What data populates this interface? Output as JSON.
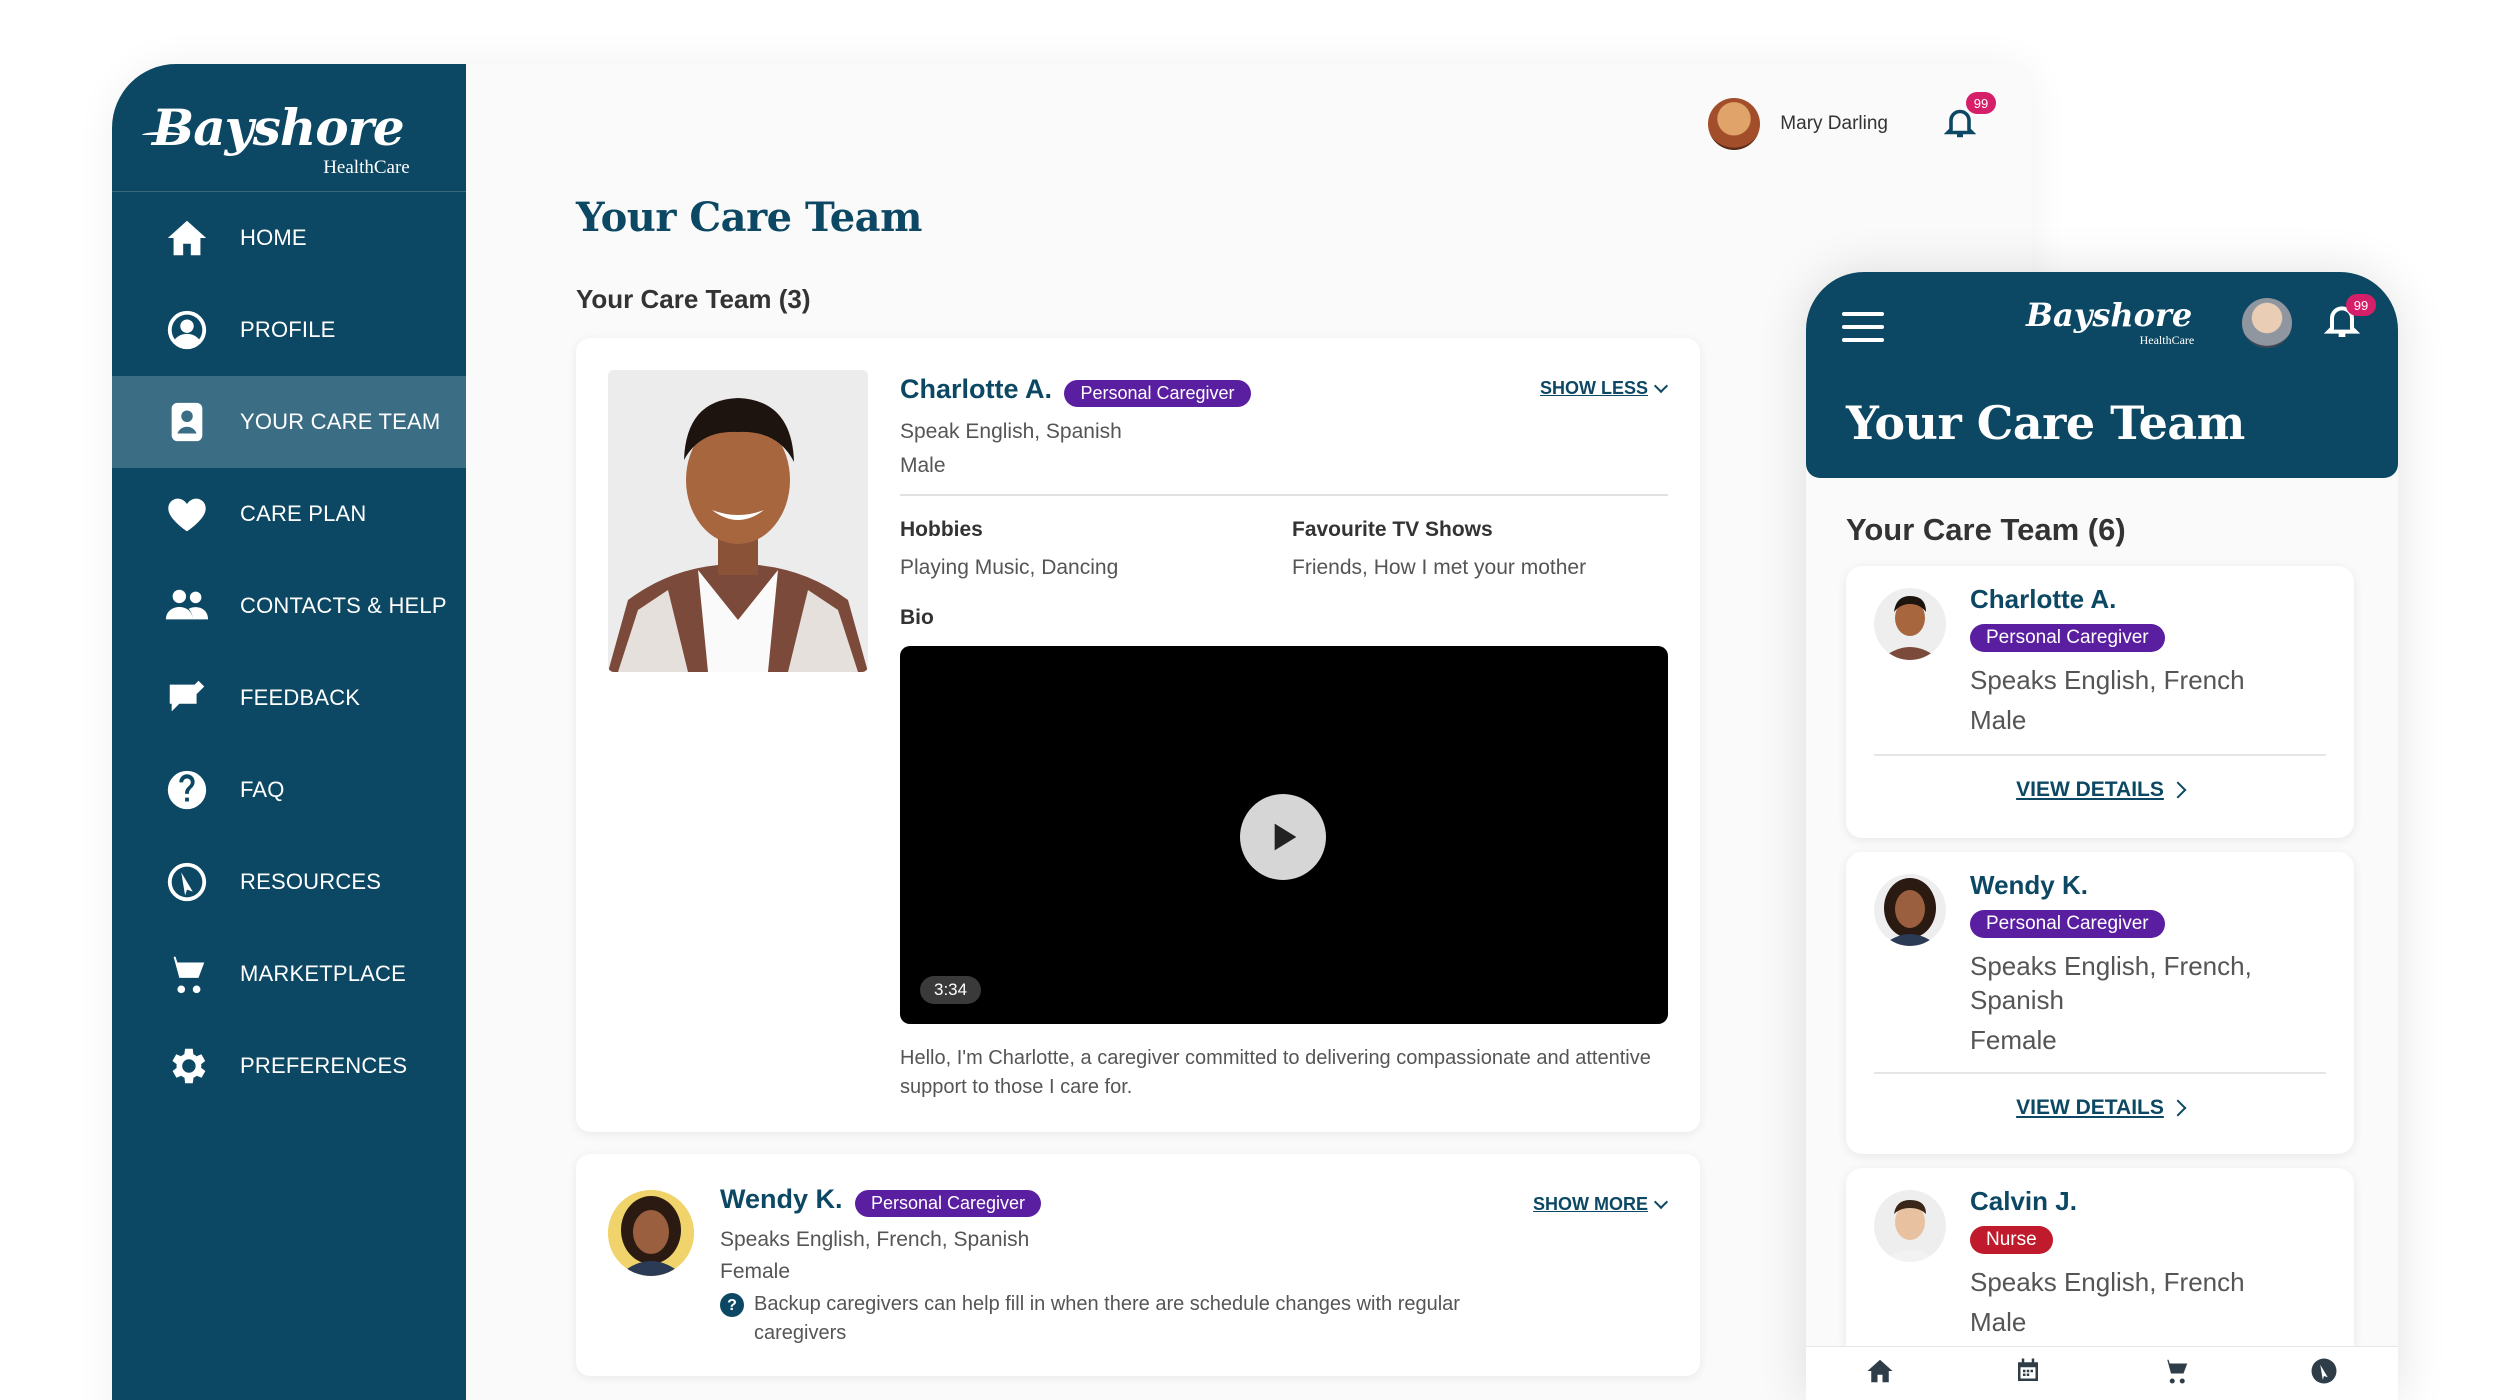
{
  "desktop": {
    "brand": "Bayshore",
    "brand_sub": "HealthCare",
    "nav": [
      {
        "label": "HOME",
        "icon": "home-icon"
      },
      {
        "label": "PROFILE",
        "icon": "profile-icon"
      },
      {
        "label": "YOUR CARE TEAM",
        "icon": "care-team-icon",
        "active": true
      },
      {
        "label": "CARE PLAN",
        "icon": "heart-icon"
      },
      {
        "label": "CONTACTS & HELP",
        "icon": "contacts-icon"
      },
      {
        "label": "FEEDBACK",
        "icon": "feedback-icon"
      },
      {
        "label": "FAQ",
        "icon": "question-icon"
      },
      {
        "label": "RESOURCES",
        "icon": "compass-icon"
      },
      {
        "label": "MARKETPLACE",
        "icon": "cart-icon"
      },
      {
        "label": "PREFERENCES",
        "icon": "gear-icon"
      }
    ],
    "user": {
      "name": "Mary Darling",
      "notifications": "99"
    },
    "page_title": "Your Care Team",
    "section_title": "Your Care Team (3)",
    "card1": {
      "name": "Charlotte A.",
      "role": "Personal Caregiver",
      "toggle": "SHOW LESS",
      "languages": "Speak English, Spanish",
      "gender": "Male",
      "hobbies_label": "Hobbies",
      "hobbies": "Playing Music, Dancing",
      "tv_label": "Favourite TV Shows",
      "tv": "Friends, How I met your mother",
      "bio_label": "Bio",
      "video_time": "3:34",
      "bio": "Hello, I'm Charlotte, a caregiver committed to delivering compassionate and attentive support to those I care for."
    },
    "card2": {
      "name": "Wendy K.",
      "role": "Personal Caregiver",
      "toggle": "SHOW MORE",
      "languages": "Speaks English, French, Spanish",
      "gender": "Female",
      "note": "Backup caregivers can help fill in when there are schedule changes with regular caregivers"
    }
  },
  "mobile": {
    "brand": "Bayshore",
    "brand_sub": "HealthCare",
    "notifications": "99",
    "title": "Your Care Team",
    "section_title": "Your Care Team (6)",
    "cards": [
      {
        "name": "Charlotte A.",
        "role": "Personal Caregiver",
        "languages": "Speaks English, French",
        "gender": "Male",
        "link": "VIEW DETAILS"
      },
      {
        "name": "Wendy K.",
        "role": "Personal Caregiver",
        "languages_1": "Speaks English, French,",
        "languages_2": "Spanish",
        "gender": "Female",
        "link": "VIEW DETAILS"
      },
      {
        "name": "Calvin J.",
        "role": "Nurse",
        "languages": "Speaks English, French",
        "gender": "Male"
      }
    ],
    "bottom_nav": [
      "home-icon",
      "calendar-icon",
      "cart-icon",
      "compass-icon"
    ]
  },
  "colors": {
    "primary": "#0c4863",
    "active_nav": "#3b6d85",
    "pill_purple": "#5a1ea0",
    "pill_red": "#c01b2d",
    "badge": "#d61f69"
  }
}
